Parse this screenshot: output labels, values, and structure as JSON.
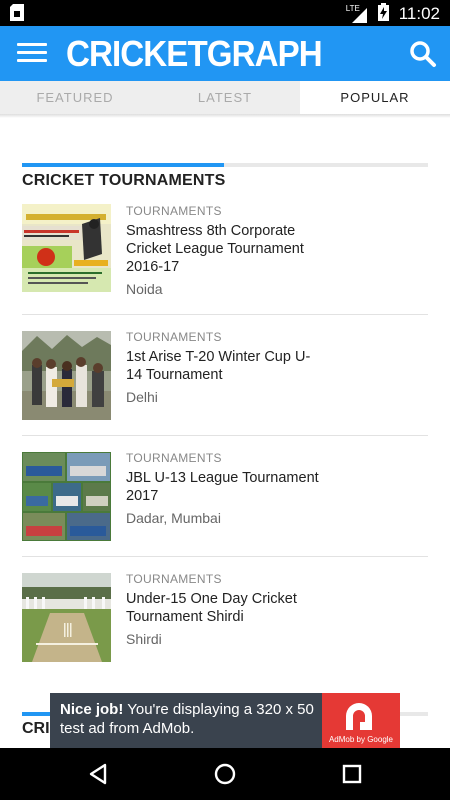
{
  "status_bar": {
    "time": "11:02",
    "network": "LTE",
    "icons": [
      "sim-card-icon",
      "lte-signal-icon",
      "battery-charging-icon"
    ]
  },
  "app_bar": {
    "title": "CRICKETGRAPH",
    "icons": [
      "hamburger-menu-icon",
      "search-icon"
    ],
    "color": "#2196f3"
  },
  "tabs": [
    {
      "label": "FEATURED",
      "active": false
    },
    {
      "label": "LATEST",
      "active": false
    },
    {
      "label": "POPULAR",
      "active": true
    }
  ],
  "section": {
    "title": "CRICKET TOURNAMENTS",
    "items": [
      {
        "category": "TOURNAMENTS",
        "title": "Smashtress 8th Corporate Cricket League Tournament 2016-17",
        "location": "Noida",
        "thumbnail": "tournament-poster-image"
      },
      {
        "category": "TOURNAMENTS",
        "title": "1st Arise T-20 Winter Cup U-14 Tournament",
        "location": "Delhi",
        "thumbnail": "award-ceremony-photo"
      },
      {
        "category": "TOURNAMENTS",
        "title": "JBL U-13 League Tournament 2017",
        "location": "Dadar, Mumbai",
        "thumbnail": "team-collage-photo"
      },
      {
        "category": "TOURNAMENTS",
        "title": "Under-15 One Day Cricket Tournament Shirdi",
        "location": "Shirdi",
        "thumbnail": "cricket-ground-photo"
      }
    ]
  },
  "section2": {
    "title_visible": "CRI"
  },
  "ad": {
    "bold": "Nice job!",
    "text": " You're displaying a 320 x 50 test ad from AdMob.",
    "caption": "AdMob by Google"
  },
  "nav_bar": {
    "icons": [
      "back-icon",
      "home-icon",
      "recents-icon"
    ]
  }
}
